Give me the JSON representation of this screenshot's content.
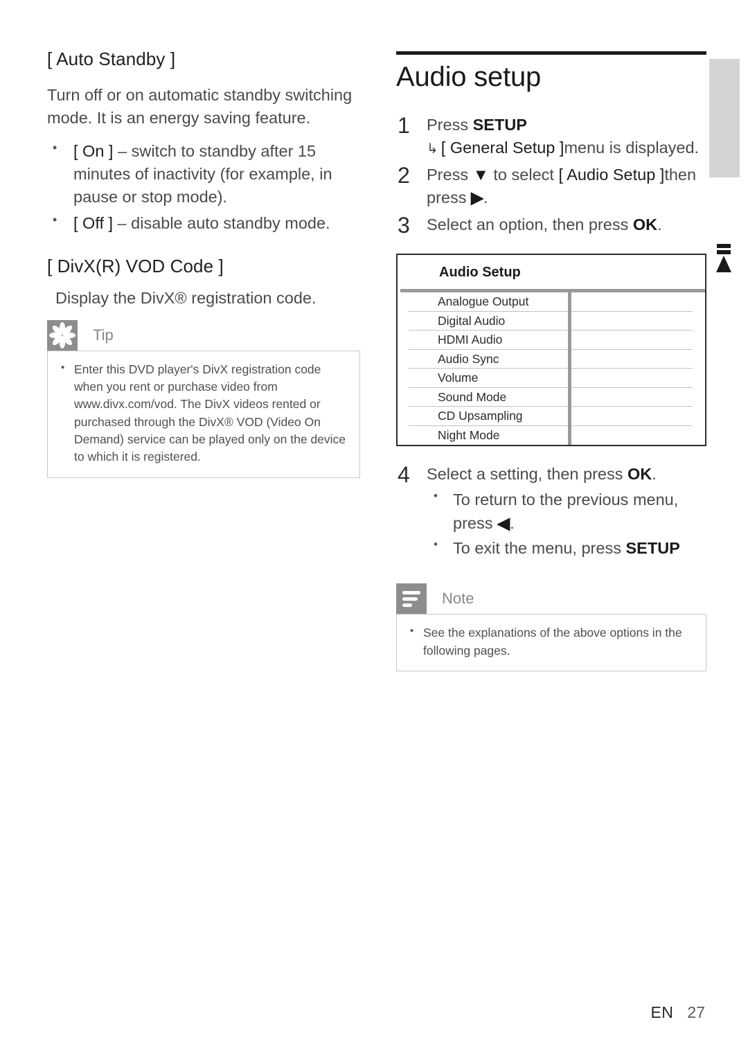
{
  "left_column": {
    "section1": {
      "heading": "[ Auto Standby ]",
      "paragraph": "Turn off or on automatic standby switching mode. It is an energy saving feature.",
      "bullets": [
        {
          "term": "[ On ]",
          "rest": " – switch to standby after 15 minutes of inactivity (for example, in pause or stop mode)."
        },
        {
          "term": "[ Off ]",
          "rest": " – disable auto standby mode."
        }
      ]
    },
    "section2": {
      "heading": "[ DivX(R) VOD Code ]",
      "paragraph": "Display the DivX® registration code."
    },
    "tip": {
      "title": "Tip",
      "icon": "asterisk-icon",
      "items": [
        "Enter this DVD player's DivX registration code when you rent or purchase video from www.divx.com/vod. The DivX videos rented or purchased through the DivX® VOD (Video On Demand) service can be played only on the device to which it is registered."
      ]
    }
  },
  "right_column": {
    "heading": "Audio setup",
    "steps": [
      {
        "number": "1",
        "text_lead": "Press ",
        "text_bold": "SETUP",
        "sub_arrow": "↳",
        "sub_strong": "[ General Setup ]",
        "sub_rest": "menu is displayed."
      },
      {
        "number": "2",
        "lead": "Press ",
        "glyph_down": "▼",
        "mid": " to select ",
        "strong": "[ Audio Setup ]",
        "tail": "then press ",
        "glyph_right": "▶",
        "period": "."
      },
      {
        "number": "3",
        "lead": "Select an option, then press ",
        "bold": "OK",
        "period": "."
      },
      {
        "number": "4",
        "lead": "Select a setting, then press ",
        "bold": "OK",
        "period": ".",
        "bullets": [
          {
            "text": "To return to the previous menu, press ",
            "glyph": "◀",
            "suffix": "."
          },
          {
            "text": "To exit the menu, press ",
            "bold": "SETUP"
          }
        ]
      }
    ],
    "table": {
      "title": "Audio Setup",
      "rows": [
        "Analogue Output",
        "Digital Audio",
        "HDMI Audio",
        "Audio Sync",
        "Volume",
        "Sound Mode",
        "CD Upsampling",
        "Night Mode"
      ],
      "values": [
        "",
        "",
        "",
        "",
        "",
        "",
        "",
        ""
      ]
    },
    "note": {
      "title": "Note",
      "icon": "note-lines-icon",
      "items": [
        "See the explanations of the above options in the following pages."
      ]
    }
  },
  "footer": {
    "language": "EN",
    "page_number": "27"
  },
  "colors": {
    "callout_icon_bg": "#8d8d8d",
    "callout_title": "#888888",
    "margin_bar": "#d4d4d4",
    "rule": "#1a1a1a",
    "table_border": "#2a2a2a",
    "table_divider": "#9a9a9a"
  }
}
